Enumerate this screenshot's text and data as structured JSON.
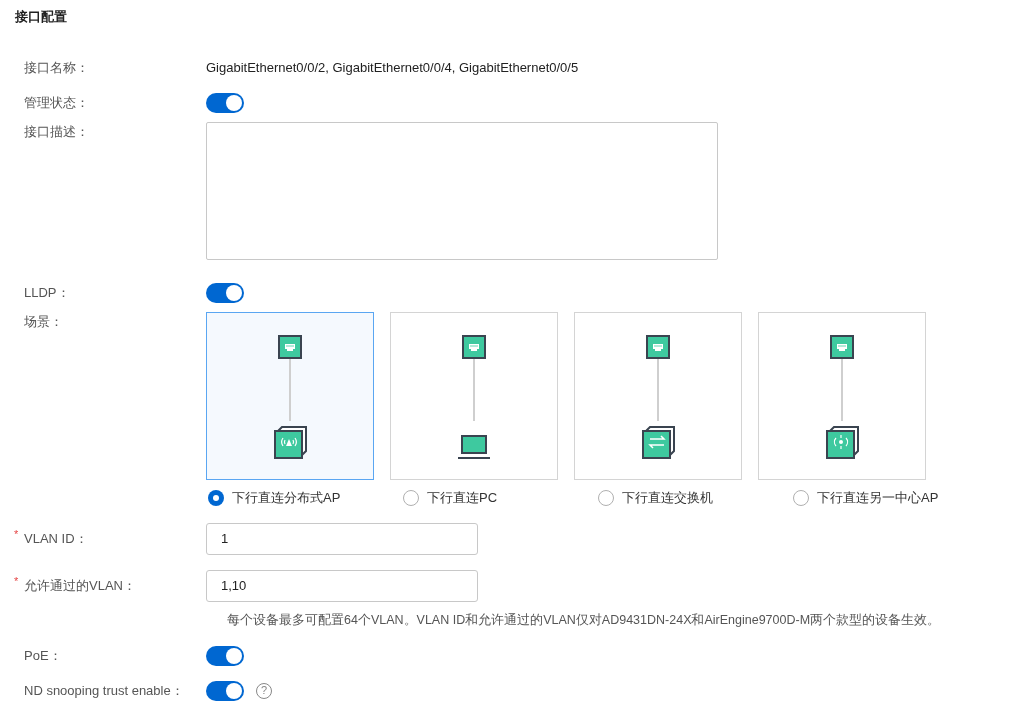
{
  "section_title": "接口配置",
  "fields": [
    {
      "kind": "text",
      "label": "接口名称：",
      "value": "GigabitEthernet0/0/2, GigabitEthernet0/0/4, GigabitEthernet0/0/5"
    },
    {
      "kind": "switch",
      "label": "管理状态：",
      "on": true
    },
    {
      "kind": "textarea",
      "label": "接口描述："
    },
    {
      "kind": "switch",
      "label": "LLDP：",
      "on": true
    },
    {
      "kind": "scenes",
      "label": "场景：",
      "options": [
        {
          "kind": "ap",
          "label": "下行直连分布式AP",
          "selected": true
        },
        {
          "kind": "pc",
          "label": "下行直连PC",
          "selected": false
        },
        {
          "kind": "switch",
          "label": "下行直连交换机",
          "selected": false
        },
        {
          "kind": "center-ap",
          "label": "下行直连另一中心AP",
          "selected": false
        }
      ]
    },
    {
      "kind": "input",
      "required_mark": "*",
      "label": "VLAN ID：",
      "value": "1"
    },
    {
      "kind": "input",
      "required_mark": "*",
      "label": "允许通过的VLAN：",
      "value": "1,10",
      "hint": "每个设备最多可配置64个VLAN。VLAN ID和允许通过的VLAN仅对AD9431DN-24X和AirEngine9700D-M两个款型的设备生效。"
    },
    {
      "kind": "switch",
      "label": "PoE：",
      "on": true
    },
    {
      "kind": "switch",
      "label": "ND snooping trust enable：",
      "on": true,
      "help_icon": "?"
    }
  ]
}
